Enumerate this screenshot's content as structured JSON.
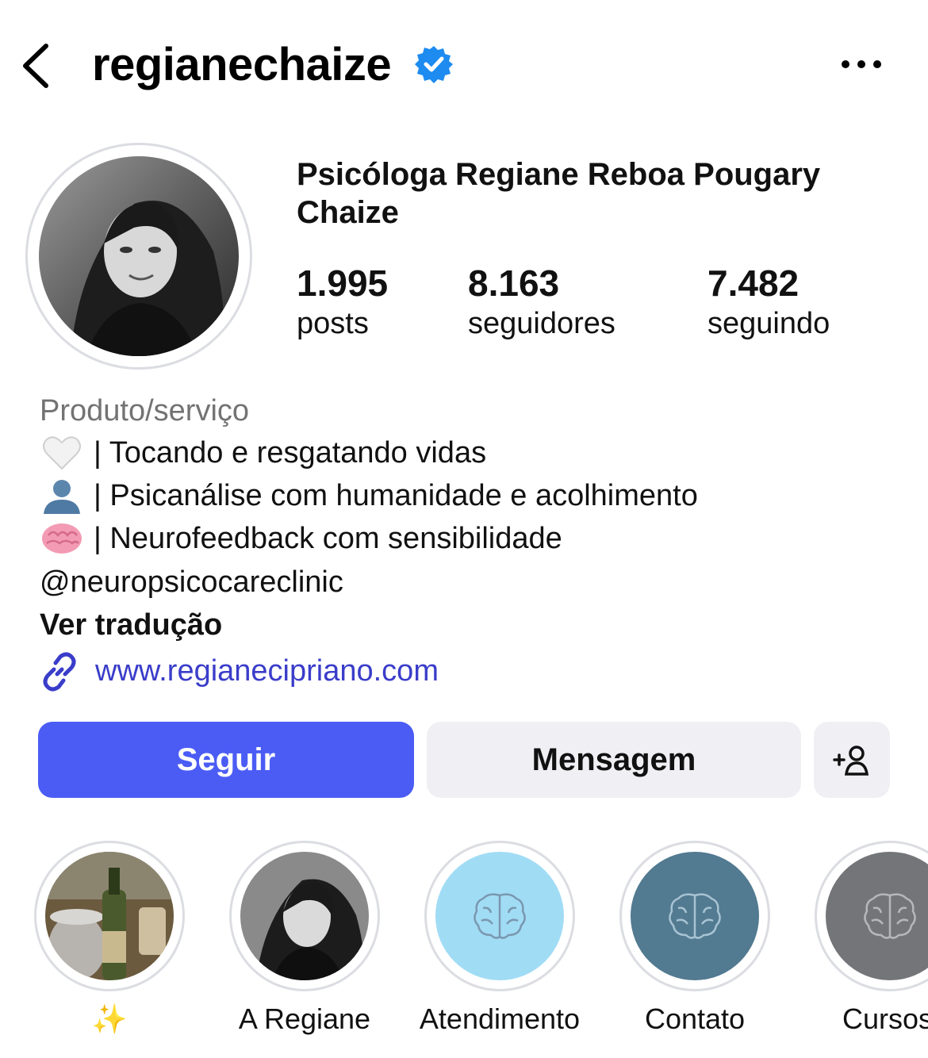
{
  "header": {
    "username": "regianechaize",
    "verified_icon": "verified-badge-icon",
    "verified_color": "#1d8bf0"
  },
  "profile": {
    "full_name": "Psicóloga Regiane Reboa Pougary Chaize",
    "stats": [
      {
        "value": "1.995",
        "label": "posts"
      },
      {
        "value": "8.163",
        "label": "seguidores"
      },
      {
        "value": "7.482",
        "label": "seguindo"
      }
    ],
    "category": "Produto/serviço",
    "bio_lines": [
      {
        "emoji": "white-heart-icon",
        "text": "| Tocando e resgatando vidas"
      },
      {
        "emoji": "bust-silhouette-icon",
        "text": "| Psicanálise com humanidade e acolhimento"
      },
      {
        "emoji": "brain-icon",
        "text": "| Neurofeedback com sensibilidade"
      }
    ],
    "mention": "@neuropsicocareclinic",
    "translate_label": "Ver tradução",
    "link": "www.regianecipriano.com"
  },
  "actions": {
    "follow_label": "Seguir",
    "message_label": "Mensagem",
    "follow_color": "#4b5cf5"
  },
  "highlights": [
    {
      "label": "✨",
      "cover": "photo"
    },
    {
      "label": "A Regiane",
      "cover": "portrait"
    },
    {
      "label": "Atendimento",
      "cover": "brain",
      "color": "#a1dcf5"
    },
    {
      "label": "Contato",
      "cover": "brain",
      "color": "#527a91"
    },
    {
      "label": "Cursos",
      "cover": "brain",
      "color": "#737578"
    }
  ]
}
